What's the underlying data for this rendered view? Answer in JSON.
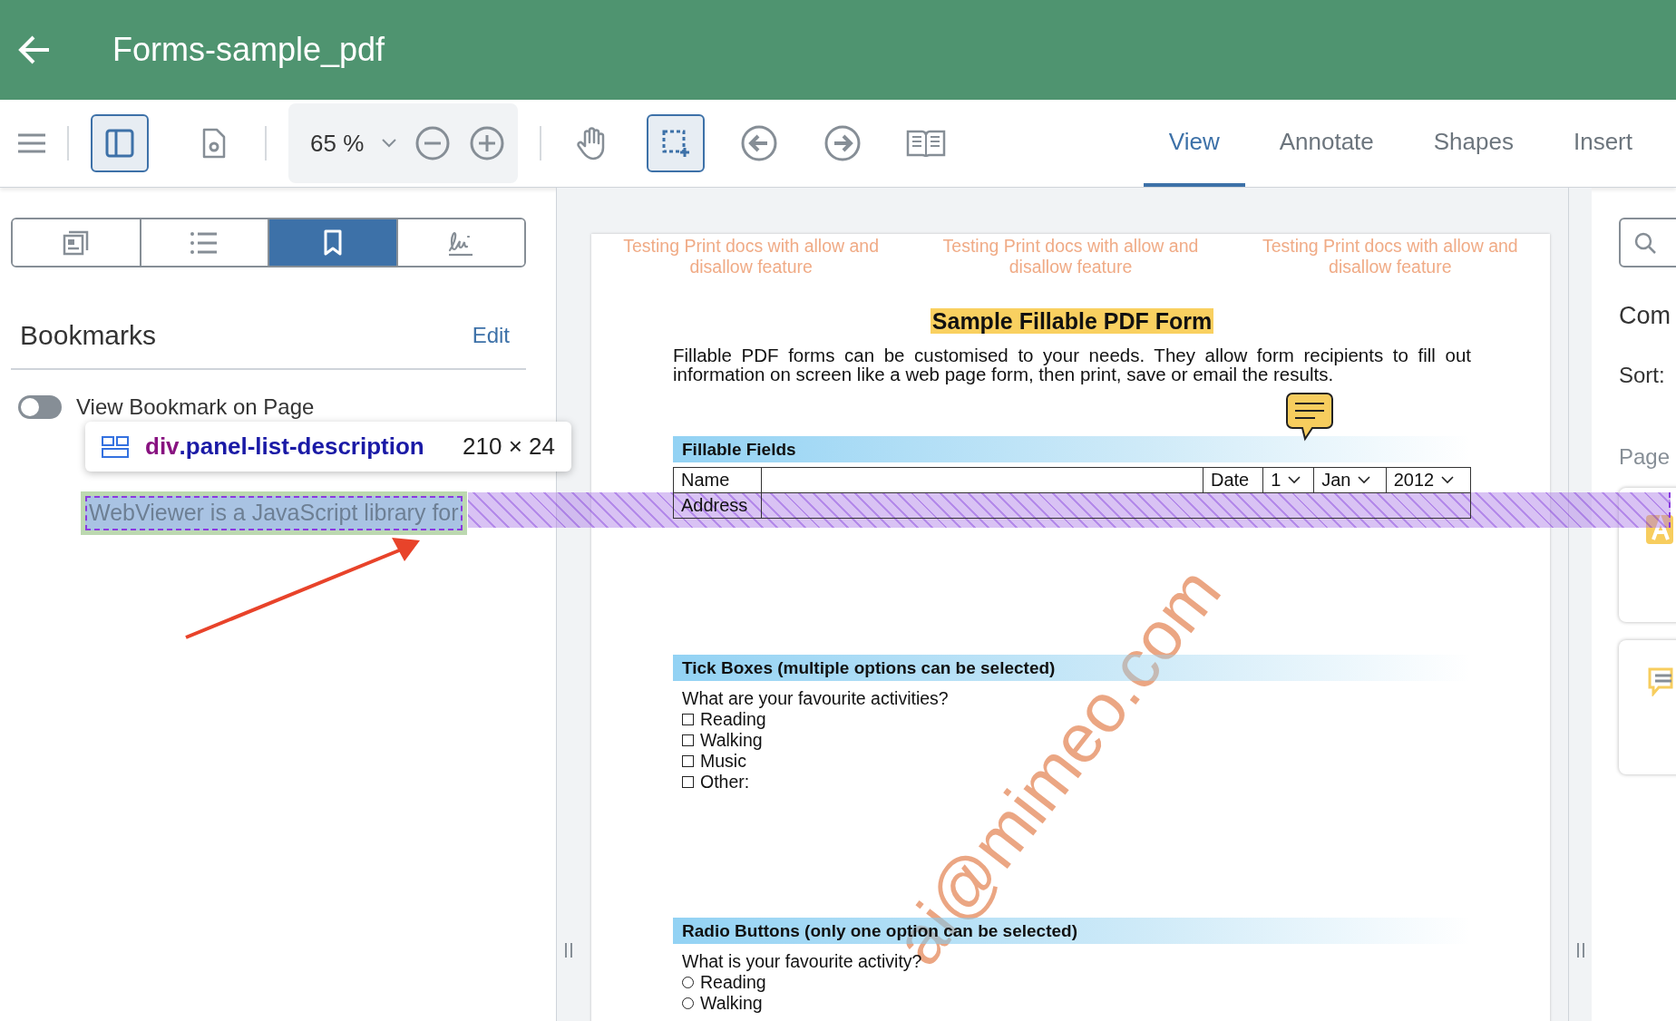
{
  "app_bar": {
    "title": "Forms-sample_pdf"
  },
  "toolbar": {
    "left_tools": [
      {
        "kind": "panel",
        "selected": true
      },
      {
        "kind": "doc-settings",
        "selected": false
      }
    ],
    "zoom": "65 %",
    "tools": [
      {
        "kind": "pan",
        "selected": false
      },
      {
        "kind": "region",
        "selected": true
      },
      {
        "kind": "prev",
        "selected": false
      },
      {
        "kind": "next",
        "selected": false
      },
      {
        "kind": "book",
        "selected": false
      }
    ],
    "tabs": [
      {
        "label": "View",
        "selected": true
      },
      {
        "label": "Annotate",
        "selected": false
      },
      {
        "label": "Shapes",
        "selected": false
      },
      {
        "label": "Insert",
        "selected": false
      }
    ]
  },
  "left_panel": {
    "tabs": [
      {
        "kind": "thumbnails",
        "selected": false
      },
      {
        "kind": "outline",
        "selected": false
      },
      {
        "kind": "bookmarks",
        "selected": true
      },
      {
        "kind": "signatures",
        "selected": false
      }
    ],
    "title": "Bookmarks",
    "edit": "Edit",
    "toggle": {
      "label": "View Bookmark on Page",
      "on": false
    },
    "bookmark_description": "WebViewer is a JavaScript library for"
  },
  "inspector_tooltip": {
    "tag": "div",
    "class_name": ".panel-list-description",
    "size": "210 × 24"
  },
  "document": {
    "header_notes": [
      {
        "lines": [
          "Testing Print docs with allow and",
          "disallow feature"
        ]
      },
      {
        "lines": [
          "Testing Print docs with allow and",
          "disallow feature"
        ]
      },
      {
        "lines": [
          "Testing Print docs with allow and",
          "disallow feature"
        ]
      }
    ],
    "title": "Sample Fillable PDF Form",
    "intro": "Fillable PDF forms can be customised to your needs. They allow form recipients to fill out information on screen like a web page form, then print, save or email the results.",
    "fillable_fields": {
      "heading": "Fillable Fields",
      "name_label": "Name",
      "date_label": "Date",
      "day": "1",
      "month": "Jan",
      "year": "2012",
      "address_label": "Address"
    },
    "tick_boxes": {
      "heading": "Tick Boxes (multiple options can be selected)",
      "question": "What are your favourite activities?",
      "options": [
        {
          "label": "Reading",
          "checked": false
        },
        {
          "label": "Walking",
          "checked": false
        },
        {
          "label": "Music",
          "checked": false
        },
        {
          "label": "Other:",
          "checked": false
        }
      ]
    },
    "radio_buttons": {
      "heading": "Radio Buttons (only one option can be selected)",
      "question": "What is your favourite activity?",
      "options": [
        {
          "label": "Reading",
          "selected": false
        },
        {
          "label": "Walking",
          "selected": false
        }
      ]
    },
    "watermark": "ai@mimeo.com"
  },
  "right_panel": {
    "title": "Com",
    "sort": "Sort:",
    "page": "Page",
    "cards": [
      {
        "kind": "text"
      },
      {
        "kind": "note"
      }
    ]
  }
}
